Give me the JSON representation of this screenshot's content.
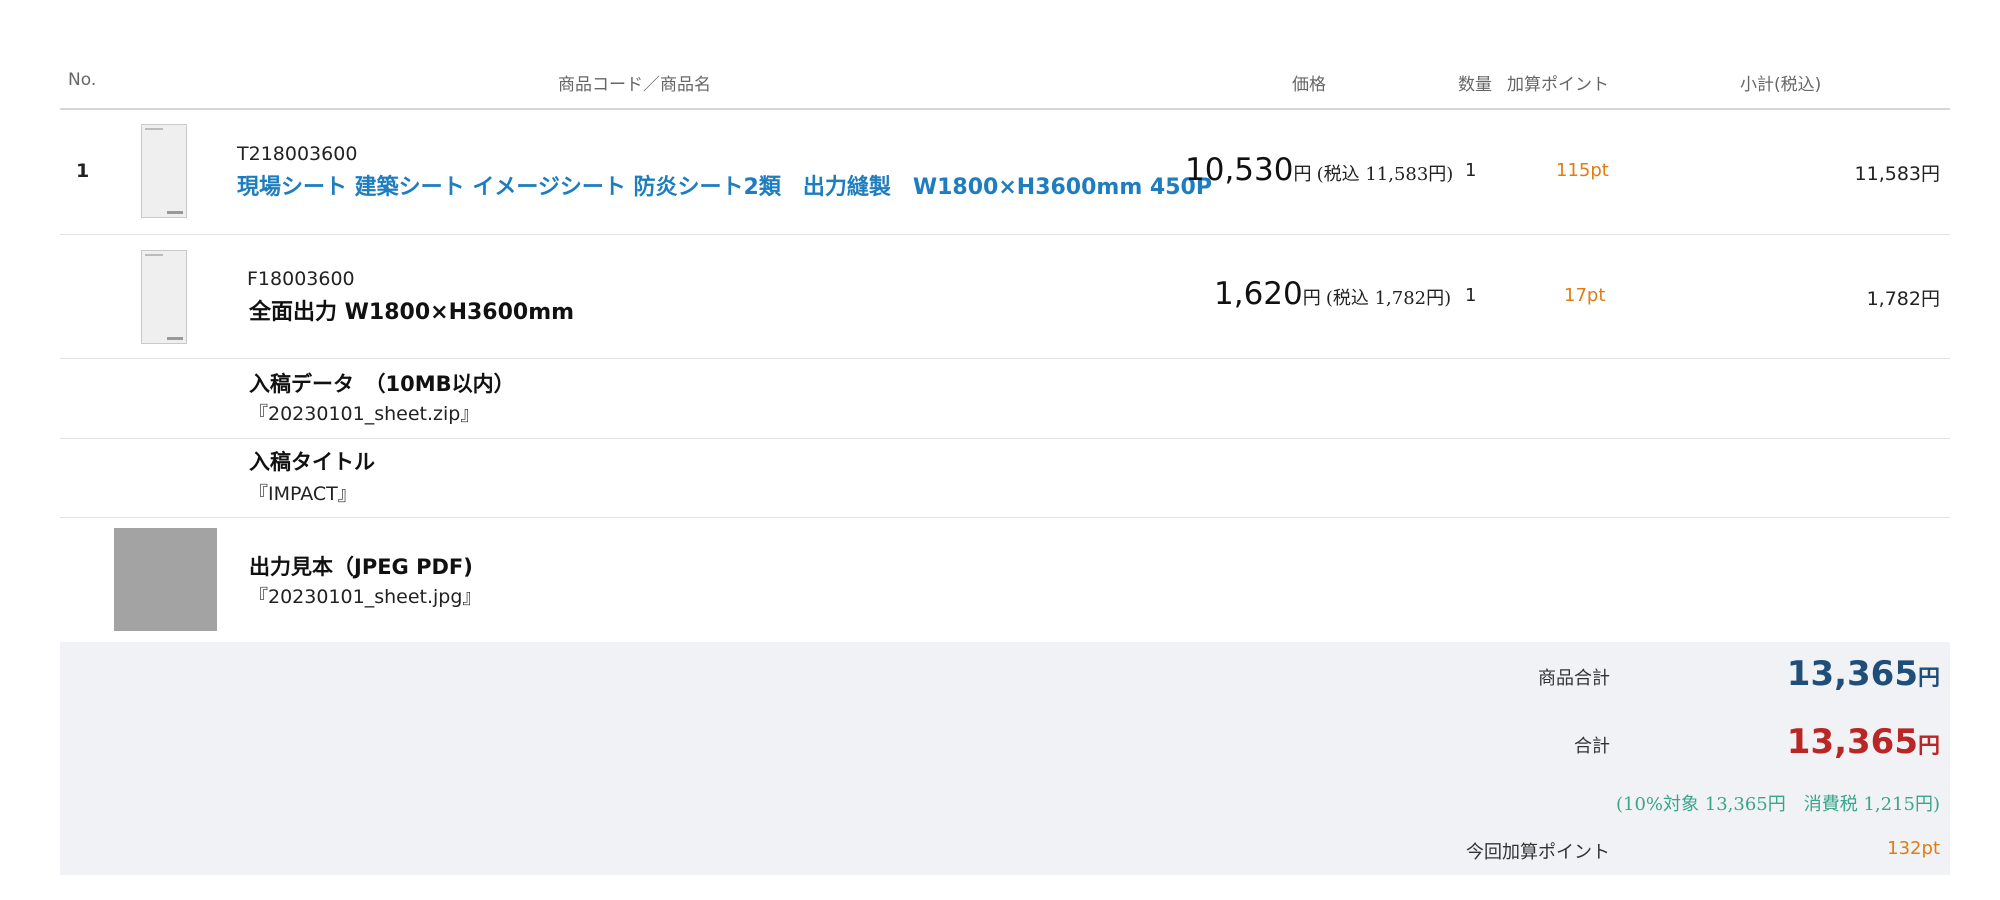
{
  "header": {
    "no": "No.",
    "product": "商品コード／商品名",
    "price": "価格",
    "qty": "数量",
    "points": "加算ポイント",
    "subtotal": "小計(税込)"
  },
  "rows": [
    {
      "no": "1",
      "code": "T218003600",
      "name": "現場シート 建築シート イメージシート 防炎シート2類　出力縫製　W1800×H3600mm 450P",
      "price": "10,530",
      "price_unit": "円",
      "price_tax": "(税込 11,583円)",
      "qty": "1",
      "points": "115pt",
      "subtotal": "11,583円"
    },
    {
      "code": "F18003600",
      "name": "全面出力 W1800×H3600mm",
      "price": "1,620",
      "price_unit": "円",
      "price_tax": "(税込 1,782円)",
      "qty": "1",
      "points": "17pt",
      "subtotal": "1,782円"
    }
  ],
  "attachments": [
    {
      "title": "入稿データ　（10MB以内）",
      "value": "『20230101_sheet.zip』"
    },
    {
      "title": "入稿タイトル",
      "value": "『IMPACT』"
    },
    {
      "title": "出力見本（JPEG PDF)",
      "value": "『20230101_sheet.jpg』"
    }
  ],
  "summary": {
    "goods_total_label": "商品合計",
    "goods_total": "13,365",
    "total_label": "合計",
    "total": "13,365",
    "yen": "円",
    "tax_note": "(10%対象 13,365円　消費税 1,215円)",
    "points_label": "今回加算ポイント",
    "points": "132pt"
  },
  "colors": {
    "link": "#1e7dbf",
    "points": "#e07d12",
    "total_blue": "#1f4e79",
    "total_red": "#b82626",
    "tax_green": "#3aa58c",
    "summary_bg": "#f0f2f5"
  }
}
